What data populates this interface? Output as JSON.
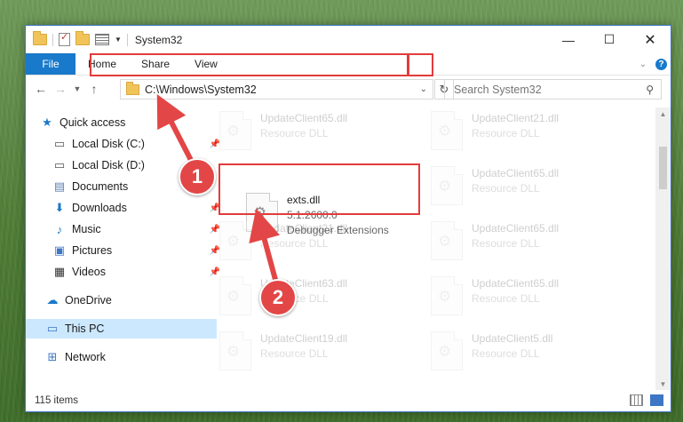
{
  "window": {
    "title": "System32"
  },
  "titlebar": {
    "minimize": "—",
    "maximize": "☐",
    "close": "✕"
  },
  "ribbon": {
    "tabs": [
      "File",
      "Home",
      "Share",
      "View"
    ]
  },
  "nav": {
    "address": "C:\\Windows\\System32",
    "search_placeholder": "Search System32"
  },
  "sidebar": {
    "items": [
      {
        "label": "Quick access",
        "icon": "star-icon"
      },
      {
        "label": "Local Disk (C:)",
        "icon": "drive-icon"
      },
      {
        "label": "Local Disk (D:)",
        "icon": "drive-icon"
      },
      {
        "label": "Documents",
        "icon": "documents-icon"
      },
      {
        "label": "Downloads",
        "icon": "download-icon"
      },
      {
        "label": "Music",
        "icon": "music-icon"
      },
      {
        "label": "Pictures",
        "icon": "pictures-icon"
      },
      {
        "label": "Videos",
        "icon": "videos-icon"
      },
      {
        "label": "OneDrive",
        "icon": "cloud-icon"
      },
      {
        "label": "This PC",
        "icon": "computer-icon"
      },
      {
        "label": "Network",
        "icon": "network-icon"
      }
    ]
  },
  "files": [
    {
      "name": "UpdateClient65.dll",
      "type": "Resource DLL"
    },
    {
      "name": "UpdateClient21.dll",
      "type": "Resource DLL"
    },
    {
      "name": "exts.dll",
      "version": "5.1.2600.0",
      "type": "Debugger Extensions"
    },
    {
      "name": "UpdateClient65.dll",
      "type": "Resource DLL"
    },
    {
      "name": "UpdateClient21.dll",
      "type": "Resource DLL"
    },
    {
      "name": "UpdateClient65.dll",
      "type": "Resource DLL"
    },
    {
      "name": "UpdateClient63.dll",
      "type": "Resource DLL"
    },
    {
      "name": "UpdateClient65.dll",
      "type": "Resource DLL"
    },
    {
      "name": "UpdateClient19.dll",
      "type": "Resource DLL"
    },
    {
      "name": "UpdateClient5.dll",
      "type": "Resource DLL"
    }
  ],
  "status": {
    "items": "115 items"
  },
  "callouts": {
    "one": "1",
    "two": "2"
  },
  "colors": {
    "accent": "#1979ca",
    "highlight": "#e23c3c"
  }
}
